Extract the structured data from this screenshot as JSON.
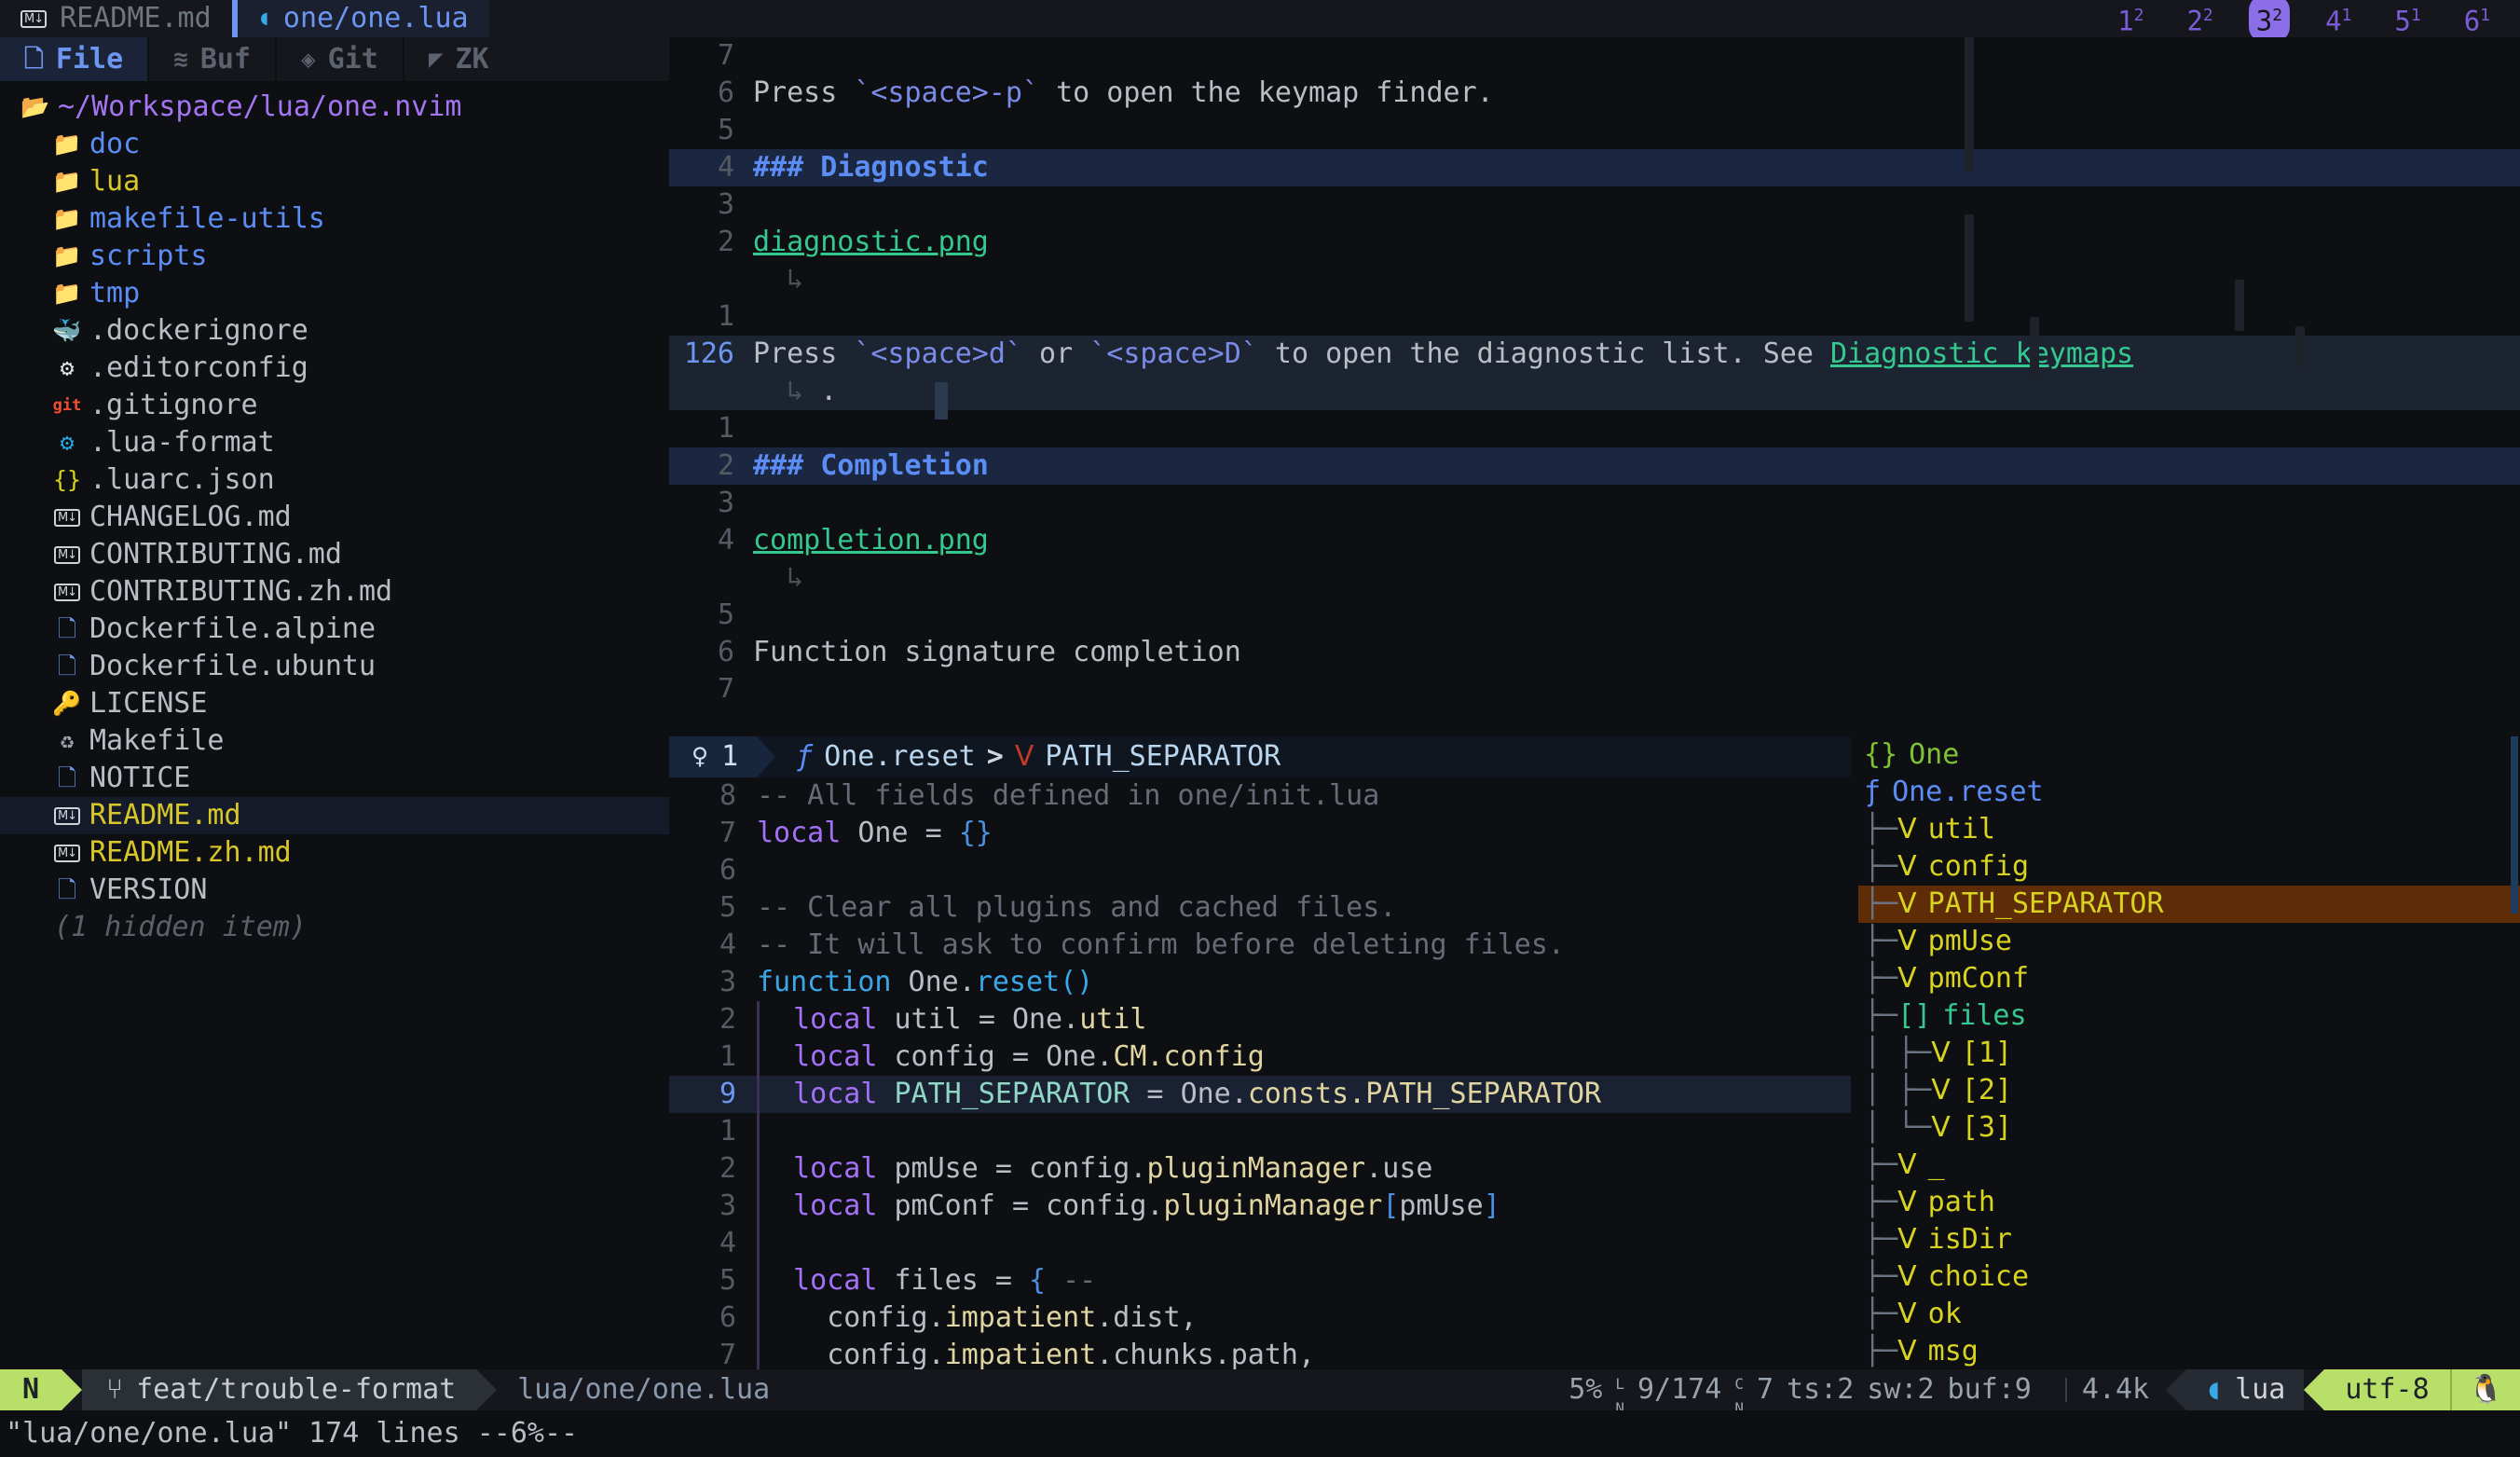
{
  "bufferline": {
    "tabs": [
      {
        "label": "README.md",
        "icon": "markdown-icon",
        "active": false
      },
      {
        "label": "one/one.lua",
        "icon": "lua-icon",
        "active": true
      }
    ],
    "tab_numbers": [
      {
        "num": "1",
        "sup": "2",
        "selected": false
      },
      {
        "num": "2",
        "sup": "2",
        "selected": false
      },
      {
        "num": "3",
        "sup": "2",
        "selected": true
      },
      {
        "num": "4",
        "sup": "1",
        "selected": false
      },
      {
        "num": "5",
        "sup": "1",
        "selected": false
      },
      {
        "num": "6",
        "sup": "1",
        "selected": false
      }
    ]
  },
  "sidebar": {
    "tabs": [
      {
        "label": "File",
        "icon": "file-icon",
        "active": true
      },
      {
        "label": "Buf",
        "icon": "layers-icon",
        "active": false
      },
      {
        "label": "Git",
        "icon": "git-diamond-icon",
        "active": false
      },
      {
        "label": "ZK",
        "icon": "notebook-icon",
        "active": false
      }
    ],
    "root": "~/Workspace/lua/one.nvim",
    "items": [
      {
        "name": "doc",
        "type": "dir",
        "icon": "folder-icon",
        "modified": false
      },
      {
        "name": "lua",
        "type": "dir",
        "icon": "folder-icon",
        "modified": true
      },
      {
        "name": "makefile-utils",
        "type": "dir",
        "icon": "folder-icon",
        "modified": false
      },
      {
        "name": "scripts",
        "type": "dir",
        "icon": "folder-icon",
        "modified": false
      },
      {
        "name": "tmp",
        "type": "dir",
        "icon": "folder-icon",
        "modified": false
      },
      {
        "name": ".dockerignore",
        "type": "file",
        "icon": "docker-icon",
        "modified": false
      },
      {
        "name": ".editorconfig",
        "type": "file",
        "icon": "gear-white-icon",
        "modified": false
      },
      {
        "name": ".gitignore",
        "type": "file",
        "icon": "git-icon",
        "modified": false
      },
      {
        "name": ".lua-format",
        "type": "file",
        "icon": "gear-blue-icon",
        "modified": false
      },
      {
        "name": ".luarc.json",
        "type": "file",
        "icon": "json-braces-icon",
        "modified": false
      },
      {
        "name": "CHANGELOG.md",
        "type": "file",
        "icon": "markdown-icon",
        "modified": false
      },
      {
        "name": "CONTRIBUTING.md",
        "type": "file",
        "icon": "markdown-icon",
        "modified": false
      },
      {
        "name": "CONTRIBUTING.zh.md",
        "type": "file",
        "icon": "markdown-icon",
        "modified": false
      },
      {
        "name": "Dockerfile.alpine",
        "type": "file",
        "icon": "document-icon",
        "modified": false
      },
      {
        "name": "Dockerfile.ubuntu",
        "type": "file",
        "icon": "document-icon",
        "modified": false
      },
      {
        "name": "LICENSE",
        "type": "file",
        "icon": "license-icon",
        "modified": false
      },
      {
        "name": "Makefile",
        "type": "file",
        "icon": "wrench-icon",
        "modified": false
      },
      {
        "name": "NOTICE",
        "type": "file",
        "icon": "document-icon",
        "modified": false
      },
      {
        "name": "README.md",
        "type": "file",
        "icon": "markdown-icon",
        "modified": true,
        "selected": true,
        "badge_dot": "●",
        "badge_sync": "↻"
      },
      {
        "name": "README.zh.md",
        "type": "file",
        "icon": "markdown-icon",
        "modified": true,
        "badge_dot": "●",
        "badge_sync": "↻"
      },
      {
        "name": "VERSION",
        "type": "file",
        "icon": "document-icon",
        "modified": false
      }
    ],
    "hidden_note": "(1 hidden item)"
  },
  "editor_top": {
    "lines": [
      {
        "num": "7",
        "segs": []
      },
      {
        "num": "6",
        "segs": [
          {
            "t": "Press ",
            "c": "txt"
          },
          {
            "t": "`<space>-p`",
            "c": "md-code"
          },
          {
            "t": " to open the keymap finder.",
            "c": "txt"
          }
        ]
      },
      {
        "num": "5",
        "segs": []
      },
      {
        "num": "4",
        "hl": true,
        "segs": [
          {
            "t": "### Diagnostic",
            "c": "md-h"
          }
        ]
      },
      {
        "num": "3",
        "segs": []
      },
      {
        "num": "2",
        "segs": [
          {
            "t": "diagnostic.png",
            "c": "md-link"
          }
        ]
      },
      {
        "num": "",
        "wrap": "↳",
        "segs": []
      },
      {
        "num": "1",
        "segs": []
      },
      {
        "num": "126",
        "cur": true,
        "segs": [
          {
            "t": "Press ",
            "c": "txt"
          },
          {
            "t": "`<space>d`",
            "c": "md-code"
          },
          {
            "t": " or ",
            "c": "txt"
          },
          {
            "t": "`<space>D`",
            "c": "md-code"
          },
          {
            "t": " to open the diagnostic list. See ",
            "c": "txt"
          },
          {
            "t": "Diagnostic keymaps",
            "c": "md-link"
          }
        ]
      },
      {
        "num": "",
        "cur": true,
        "wrap": "↳",
        "segs": [
          {
            "t": ".",
            "c": "txt"
          }
        ]
      },
      {
        "num": "1",
        "segs": []
      },
      {
        "num": "2",
        "hl": true,
        "segs": [
          {
            "t": "### Completion",
            "c": "md-h"
          }
        ]
      },
      {
        "num": "3",
        "segs": []
      },
      {
        "num": "4",
        "segs": [
          {
            "t": "completion.png",
            "c": "md-link"
          }
        ]
      },
      {
        "num": "",
        "wrap": "↳",
        "segs": []
      },
      {
        "num": "5",
        "segs": []
      },
      {
        "num": "6",
        "segs": [
          {
            "t": "Function signature completion",
            "c": "txt"
          }
        ]
      },
      {
        "num": "7",
        "segs": []
      }
    ]
  },
  "editor_bottom": {
    "winbar": {
      "lamp_icon": "lightbulb-icon",
      "diagnostic_count": "1",
      "fn_icon": "ƒ",
      "fn_name": "One.reset",
      "chevron": ">",
      "var_icon": "Ⅴ",
      "var_name": "PATH_SEPARATOR"
    },
    "lines": [
      {
        "num": "8",
        "segs": [
          {
            "t": "-- All fields defined in one/init.lua",
            "c": "cm"
          }
        ]
      },
      {
        "num": "7",
        "segs": [
          {
            "t": "local",
            "c": "kw"
          },
          {
            "t": " One ",
            "c": "id"
          },
          {
            "t": "= ",
            "c": "op"
          },
          {
            "t": "{}",
            "c": "br"
          }
        ]
      },
      {
        "num": "6",
        "segs": []
      },
      {
        "num": "5",
        "segs": [
          {
            "t": "-- Clear all plugins and cached files.",
            "c": "cm"
          }
        ]
      },
      {
        "num": "4",
        "segs": [
          {
            "t": "-- It will ask to confirm before deleting files.",
            "c": "cm"
          }
        ]
      },
      {
        "num": "3",
        "segs": [
          {
            "t": "function",
            "c": "kw2"
          },
          {
            "t": " One.",
            "c": "id"
          },
          {
            "t": "reset()",
            "c": "fn"
          }
        ]
      },
      {
        "num": "2",
        "indent": 1,
        "segs": [
          {
            "t": "  local",
            "c": "kw"
          },
          {
            "t": " util ",
            "c": "id"
          },
          {
            "t": "= ",
            "c": "op"
          },
          {
            "t": "One.",
            "c": "id"
          },
          {
            "t": "util",
            "c": "prop"
          }
        ]
      },
      {
        "num": "1",
        "indent": 1,
        "segs": [
          {
            "t": "  local",
            "c": "kw"
          },
          {
            "t": " config ",
            "c": "id"
          },
          {
            "t": "= ",
            "c": "op"
          },
          {
            "t": "One.",
            "c": "id"
          },
          {
            "t": "CM.config",
            "c": "prop"
          }
        ]
      },
      {
        "num": "9",
        "cur": true,
        "indent": 1,
        "segs": [
          {
            "t": "  local",
            "c": "kw"
          },
          {
            "t": " ",
            "c": "id"
          },
          {
            "t": "PATH_SEPARATOR",
            "c": "var"
          },
          {
            "t": " = ",
            "c": "op"
          },
          {
            "t": "One.",
            "c": "id"
          },
          {
            "t": "consts.PATH_SEPARATOR",
            "c": "prop"
          }
        ]
      },
      {
        "num": "1",
        "indent": 1,
        "segs": []
      },
      {
        "num": "2",
        "indent": 1,
        "segs": [
          {
            "t": "  local",
            "c": "kw"
          },
          {
            "t": " pmUse ",
            "c": "id"
          },
          {
            "t": "= ",
            "c": "op"
          },
          {
            "t": "config.",
            "c": "id"
          },
          {
            "t": "pluginManager",
            "c": "prop"
          },
          {
            "t": ".use",
            "c": "id"
          }
        ]
      },
      {
        "num": "3",
        "indent": 1,
        "segs": [
          {
            "t": "  local",
            "c": "kw"
          },
          {
            "t": " pmConf ",
            "c": "id"
          },
          {
            "t": "= ",
            "c": "op"
          },
          {
            "t": "config.",
            "c": "id"
          },
          {
            "t": "pluginManager",
            "c": "prop"
          },
          {
            "t": "[",
            "c": "br"
          },
          {
            "t": "pmUse",
            "c": "id"
          },
          {
            "t": "]",
            "c": "br"
          }
        ]
      },
      {
        "num": "4",
        "indent": 1,
        "segs": []
      },
      {
        "num": "5",
        "indent": 1,
        "segs": [
          {
            "t": "  local",
            "c": "kw"
          },
          {
            "t": " files ",
            "c": "id"
          },
          {
            "t": "= ",
            "c": "op"
          },
          {
            "t": "{",
            "c": "br"
          },
          {
            "t": " --",
            "c": "cm"
          }
        ]
      },
      {
        "num": "6",
        "indent": 1,
        "segs": [
          {
            "t": "    config.",
            "c": "id"
          },
          {
            "t": "impatient",
            "c": "prop"
          },
          {
            "t": ".dist,",
            "c": "id"
          }
        ]
      },
      {
        "num": "7",
        "indent": 1,
        "segs": [
          {
            "t": "    config.",
            "c": "id"
          },
          {
            "t": "impatient",
            "c": "prop"
          },
          {
            "t": ".chunks.path,",
            "c": "id"
          }
        ]
      }
    ]
  },
  "outline": {
    "items": [
      {
        "guide": "",
        "icon": "{}",
        "icon_class": "o-mod",
        "name": "One",
        "name_class": "mod",
        "indent": 0
      },
      {
        "guide": "",
        "icon": "ƒ",
        "icon_class": "o-fn",
        "name": "One.reset",
        "name_class": "fn",
        "indent": 0
      },
      {
        "guide": "├─",
        "icon": "Ⅴ",
        "icon_class": "o-var",
        "name": "util",
        "name_class": "var",
        "indent": 1
      },
      {
        "guide": "├─",
        "icon": "Ⅴ",
        "icon_class": "o-var",
        "name": "config",
        "name_class": "var",
        "indent": 1
      },
      {
        "guide": "├─",
        "icon": "Ⅴ",
        "icon_class": "o-var",
        "name": "PATH_SEPARATOR",
        "name_class": "var",
        "indent": 1,
        "selected": true
      },
      {
        "guide": "├─",
        "icon": "Ⅴ",
        "icon_class": "o-var",
        "name": "pmUse",
        "name_class": "var",
        "indent": 1
      },
      {
        "guide": "├─",
        "icon": "Ⅴ",
        "icon_class": "o-var",
        "name": "pmConf",
        "name_class": "var",
        "indent": 1
      },
      {
        "guide": "├─",
        "icon": "[]",
        "icon_class": "o-arr",
        "name": "files",
        "name_class": "arr",
        "indent": 1
      },
      {
        "guide": "│ ├─",
        "icon": "Ⅴ",
        "icon_class": "o-var",
        "name": "[1]",
        "name_class": "var",
        "indent": 2
      },
      {
        "guide": "│ ├─",
        "icon": "Ⅴ",
        "icon_class": "o-var",
        "name": "[2]",
        "name_class": "var",
        "indent": 2
      },
      {
        "guide": "│ └─",
        "icon": "Ⅴ",
        "icon_class": "o-var",
        "name": "[3]",
        "name_class": "var",
        "indent": 2
      },
      {
        "guide": "├─",
        "icon": "Ⅴ",
        "icon_class": "o-var",
        "name": "_",
        "name_class": "var",
        "indent": 1
      },
      {
        "guide": "├─",
        "icon": "Ⅴ",
        "icon_class": "o-var",
        "name": "path",
        "name_class": "var",
        "indent": 1
      },
      {
        "guide": "├─",
        "icon": "Ⅴ",
        "icon_class": "o-var",
        "name": "isDir",
        "name_class": "var",
        "indent": 1
      },
      {
        "guide": "├─",
        "icon": "Ⅴ",
        "icon_class": "o-var",
        "name": "choice",
        "name_class": "var",
        "indent": 1
      },
      {
        "guide": "├─",
        "icon": "Ⅴ",
        "icon_class": "o-var",
        "name": "ok",
        "name_class": "var",
        "indent": 1
      },
      {
        "guide": "├─",
        "icon": "Ⅴ",
        "icon_class": "o-var",
        "name": "msg",
        "name_class": "var",
        "indent": 1
      }
    ]
  },
  "statusline": {
    "mode": "N",
    "branch_icon": "git-branch-icon",
    "branch": "feat/trouble-format",
    "path": "lua/one/one.lua",
    "percent": "5%",
    "line_label": "L",
    "line_sub": "N",
    "line_pos": "9/174",
    "col_label": "C",
    "col_sub": "N",
    "col_pos": "7",
    "ts": "ts:2",
    "sw": "sw:2",
    "buf": "buf:9",
    "filesize": "4.4k",
    "lang_icon": "lua-icon",
    "lang": "lua",
    "encoding": "utf-8",
    "os_icon": "linux-penguin-icon"
  },
  "cmdline": {
    "text": "\"lua/one/one.lua\" 174 lines --6%--"
  }
}
